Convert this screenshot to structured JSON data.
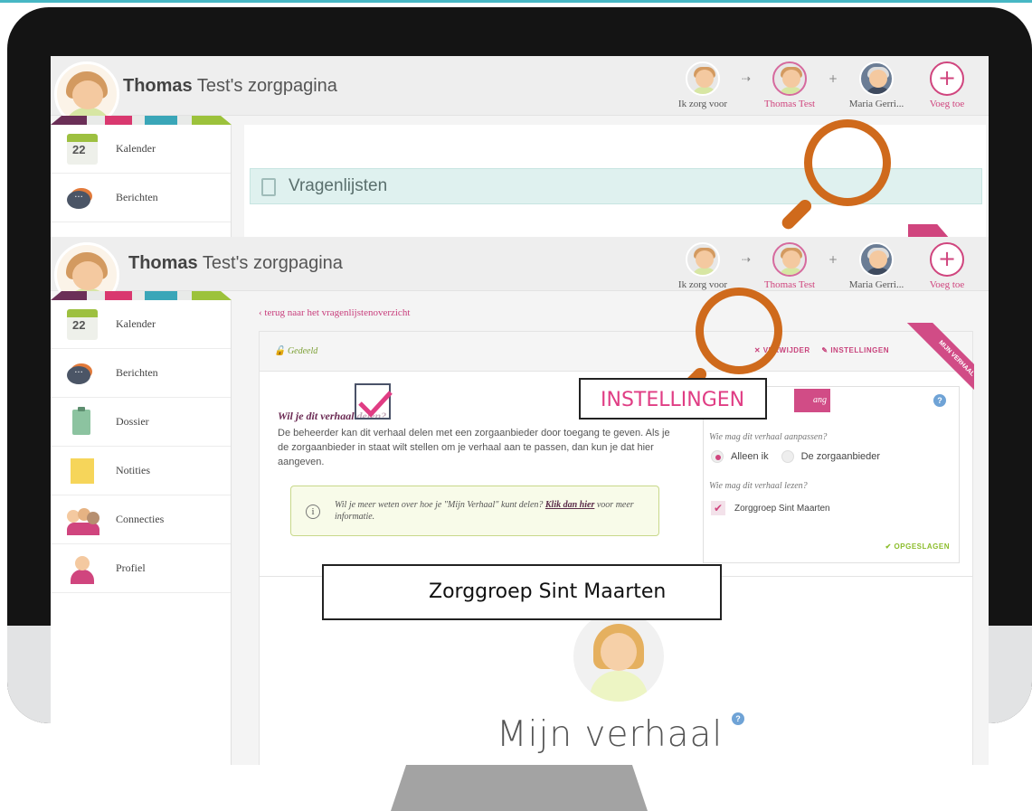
{
  "back_screen": {
    "page_title_bold": "Thomas",
    "page_title_rest": " Test's zorgpagina",
    "nav": [
      {
        "label": "Ik zorg voor"
      },
      {
        "label": "Thomas Test"
      },
      {
        "label": "Maria Gerri..."
      },
      {
        "label": "Voeg toe"
      }
    ],
    "sidebar": [
      {
        "label": "Kalender",
        "icon": "calendar-icon",
        "day": "22"
      },
      {
        "label": "Berichten",
        "icon": "messages-icon"
      }
    ],
    "section_title": "Vragenlijsten"
  },
  "front_screen": {
    "page_title_bold": "Thomas",
    "page_title_rest": " Test's zorgpagina",
    "nav": [
      {
        "label": "Ik zorg voor"
      },
      {
        "label": "Thomas Test"
      },
      {
        "label": "Maria Gerri..."
      },
      {
        "label": "Voeg toe"
      }
    ],
    "sidebar": [
      {
        "label": "Kalender",
        "icon": "calendar-icon",
        "day": "22"
      },
      {
        "label": "Berichten",
        "icon": "messages-icon"
      },
      {
        "label": "Dossier",
        "icon": "clipboard-icon"
      },
      {
        "label": "Notities",
        "icon": "notes-icon"
      },
      {
        "label": "Connecties",
        "icon": "connections-icon"
      },
      {
        "label": "Profiel",
        "icon": "profile-icon"
      }
    ],
    "back_link": "‹ terug naar het vragenlijstenoverzicht",
    "shared_label": "Gedeeld",
    "actions": {
      "remove": "✕ VERWIJDER",
      "settings": "✎ INSTELLINGEN"
    },
    "ribbon": "MIJN VERHAAL",
    "question_title": "Wil je dit verhaal delen?",
    "question_text": "De beheerder kan dit verhaal delen met een zorgaanbieder door toegang te geven. Als je de zorgaanbieder in staat wilt stellen om je verhaal aan te passen, dan kun je dat hier aangeven.",
    "info_text": "Wil je meer weten over hoe je \"Mijn Verhaal\" kunt delen?",
    "info_link": "Klik dan hier",
    "info_after": "voor meer informatie.",
    "settings_panel": {
      "tab_label": "ang",
      "q_edit": "Wie mag dit verhaal aanpassen?",
      "opt_alleen": "Alleen ik",
      "opt_zorg": "De zorgaanbieder",
      "selected": "Alleen ik",
      "q_read": "Wie mag dit verhaal lezen?",
      "reader": "Zorggroep Sint Maarten",
      "reader_checked": true,
      "saved_label": "✔ OPGESLAGEN"
    },
    "story_title": "Mijn verhaal"
  },
  "overlays": {
    "callout_settings": "INSTELLINGEN",
    "callout_group": "Zorggroep Sint Maarten"
  },
  "colors": {
    "accent_pink": "#d0457e",
    "accent_orange": "#cf6a1c",
    "teal": "#47b7c4"
  }
}
